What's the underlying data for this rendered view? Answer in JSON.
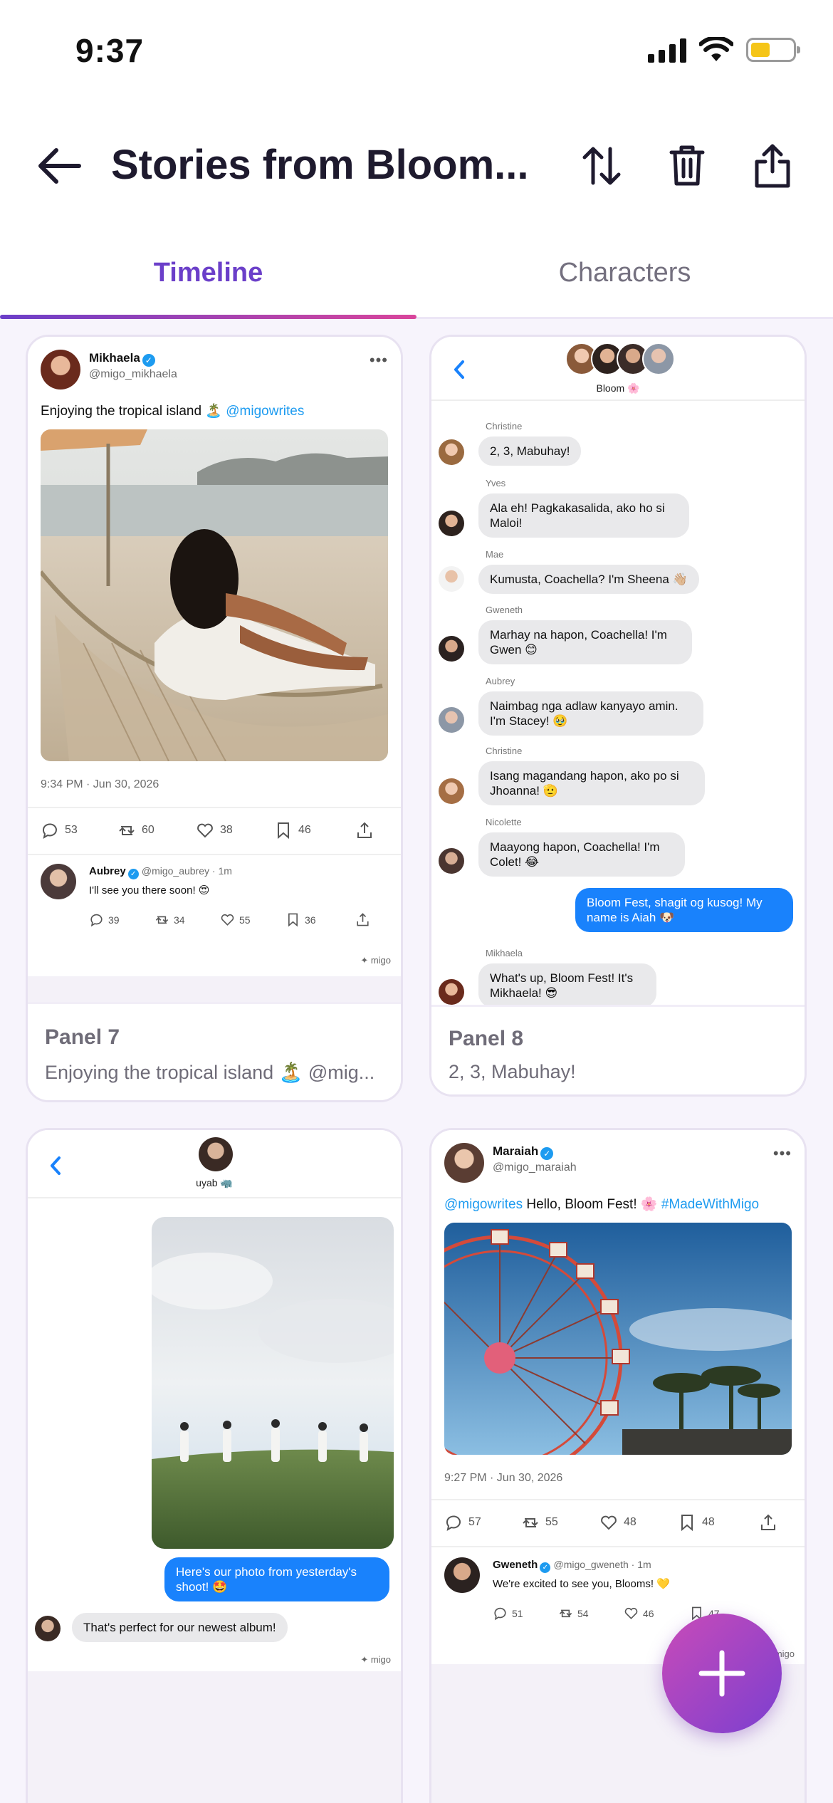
{
  "status": {
    "time": "9:37"
  },
  "header": {
    "title": "Stories from Bloom..."
  },
  "tabs": [
    {
      "label": "Timeline"
    },
    {
      "label": "Characters"
    }
  ],
  "panels": [
    {
      "label": "Panel 7",
      "subtitle": "Enjoying the tropical island 🏝️ @mig...",
      "tweet": {
        "name": "Mikhaela",
        "handle": "@migo_mikhaela",
        "text": "Enjoying the tropical island 🏝️",
        "mention": "@migowrites",
        "timestamp": "9:34 PM · Jun 30, 2026",
        "replies": "53",
        "retweets": "60",
        "likes": "38",
        "bookmarks": "46",
        "reply": {
          "name": "Aubrey",
          "handle": "@migo_aubrey · 1m",
          "text": "I'll see you there soon! 😍",
          "replies": "39",
          "retweets": "34",
          "likes": "55",
          "bookmarks": "36"
        },
        "watermark": "✦ migo"
      }
    },
    {
      "label": "Panel 8",
      "subtitle": "2, 3, Mabuhay!",
      "chat": {
        "group_name": "Bloom 🌸",
        "messages": [
          {
            "sender": "Christine",
            "text": "2, 3, Mabuhay!"
          },
          {
            "sender": "Yves",
            "text": "Ala eh! Pagkakasalida, ako ho si Maloi!"
          },
          {
            "sender": "Mae",
            "text": "Kumusta, Coachella? I'm Sheena 👋🏼"
          },
          {
            "sender": "Gweneth",
            "text": "Marhay na hapon, Coachella! I'm Gwen 😊"
          },
          {
            "sender": "Aubrey",
            "text": "Naimbag nga adlaw kanyayo amin. I'm Stacey! 🥹"
          },
          {
            "sender": "Christine",
            "text": "Isang magandang hapon, ako po si Jhoanna! 🫡"
          },
          {
            "sender": "Nicolette",
            "text": "Maayong hapon, Coachella! I'm Colet! 😂"
          },
          {
            "sender": "",
            "text": "Bloom Fest, shagit og kusog! My name is Aiah 🐶"
          },
          {
            "sender": "Mikhaela",
            "text": "What's up, Bloom Fest! It's Mikhaela! 😎"
          }
        ]
      }
    },
    {
      "chat": {
        "contact_name": "uyab 🦏",
        "my_message": "Here's our photo from yesterday's shoot! 🤩",
        "their_message": "That's perfect for our newest album!",
        "watermark": "✦ migo"
      }
    },
    {
      "tweet": {
        "name": "Maraiah",
        "handle": "@migo_maraiah",
        "mention": "@migowrites",
        "text": "Hello, Bloom Fest! 🌸",
        "hashtag": "#MadeWithMigo",
        "timestamp": "9:27 PM · Jun 30, 2026",
        "replies": "57",
        "retweets": "55",
        "likes": "48",
        "bookmarks": "48",
        "reply": {
          "name": "Gweneth",
          "handle": "@migo_gweneth · 1m",
          "text": "We're excited to see you, Blooms! 💛",
          "replies": "51",
          "retweets": "54",
          "likes": "46",
          "bookmarks": "47"
        },
        "watermark": "migo"
      }
    }
  ],
  "colors": {
    "accent": "#6B3FC9",
    "accent2": "#D9459B",
    "imessage_blue": "#1982FC",
    "twitter_blue": "#1D9BF0"
  },
  "icons": [
    "back-arrow-icon",
    "sort-icon",
    "trash-icon",
    "share-icon",
    "plus-icon"
  ]
}
